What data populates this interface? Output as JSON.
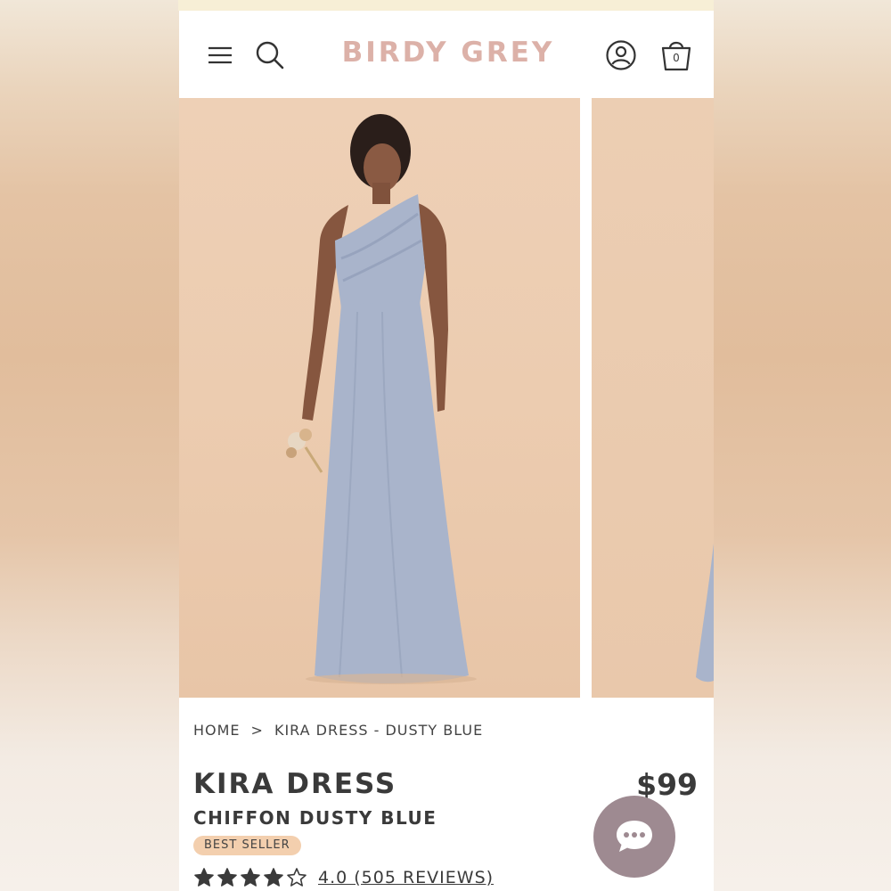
{
  "header": {
    "logo": "BIRDY GREY",
    "cart_count": "0",
    "icons": [
      "menu-icon",
      "search-icon",
      "account-icon",
      "cart-icon"
    ]
  },
  "breadcrumb": {
    "home": "HOME",
    "separator": ">",
    "current": "KIRA DRESS - DUSTY BLUE"
  },
  "product": {
    "name": "KIRA DRESS",
    "subtitle": "CHIFFON DUSTY BLUE",
    "price": "$99",
    "badge": "BEST SELLER",
    "rating": 4,
    "rating_max": 5,
    "rating_text": "4.0 (505 REVIEWS)"
  },
  "colors": {
    "logo": "#dcb1a8",
    "badge_bg": "#f3cfae",
    "chat_button": "#9e8a91",
    "dress": "#a9b4cb",
    "photo_bg": "#ecccb0"
  }
}
